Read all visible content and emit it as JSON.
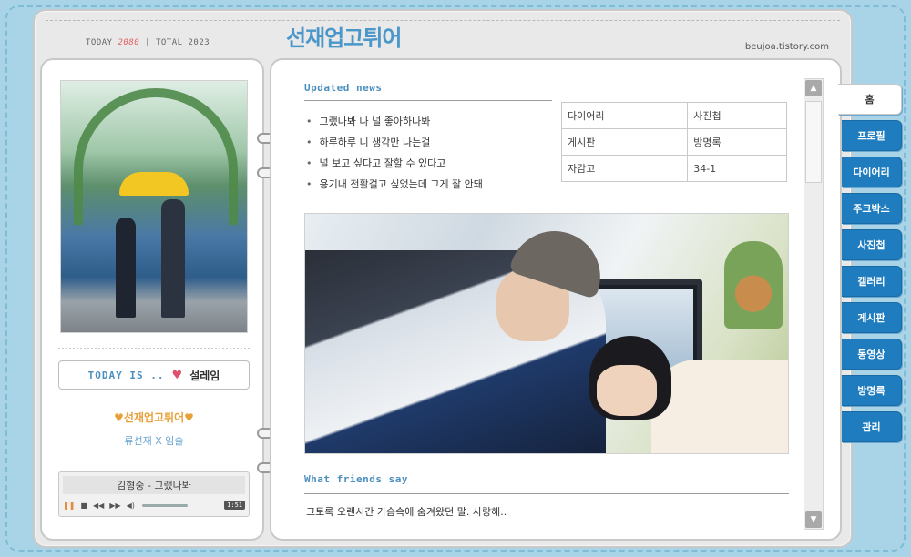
{
  "header": {
    "counter_label": "TODAY",
    "counter_today": "2080",
    "counter_sep": "|",
    "counter_total_label": "TOTAL",
    "counter_total": "2023",
    "logo_main": "선재업고튀어",
    "blog_url": "beujoa.tistory.com"
  },
  "sidebar": {
    "today_label": "TODAY IS ..",
    "today_mood": "설레임",
    "deco_title": "♥선재업고튀어♥",
    "couple": "류선재 X 임솔",
    "player": {
      "track": "김형중 - 그랬나봐",
      "time": "1:51"
    }
  },
  "main": {
    "updated_title": "Updated news",
    "news": [
      "그랬나봐 나 널 좋아하나봐",
      "하루하루 니 생각만 나는걸",
      "널 보고 싶다고 잘할 수 있다고",
      "용기내 전활걸고 싶었는데 그게 잘 안돼"
    ],
    "nav_table": [
      [
        "다이어리",
        "사진첩"
      ],
      [
        "게시판",
        "방명록"
      ],
      [
        "자감고",
        "34-1"
      ]
    ],
    "friends_title": "What friends say",
    "friends_text": "그토록 오랜시간 가슴속에 숨겨왔던 말. 사랑해.."
  },
  "tabs": [
    "홈",
    "프로필",
    "다이어리",
    "주크박스",
    "사진첩",
    "갤러리",
    "게시판",
    "동영상",
    "방명록",
    "관리"
  ],
  "colors": {
    "background": "#a9d3e6",
    "tab_blue": "#1f7dbf",
    "accent_pink": "#e46a8a",
    "accent_blue": "#4a8fbf"
  }
}
